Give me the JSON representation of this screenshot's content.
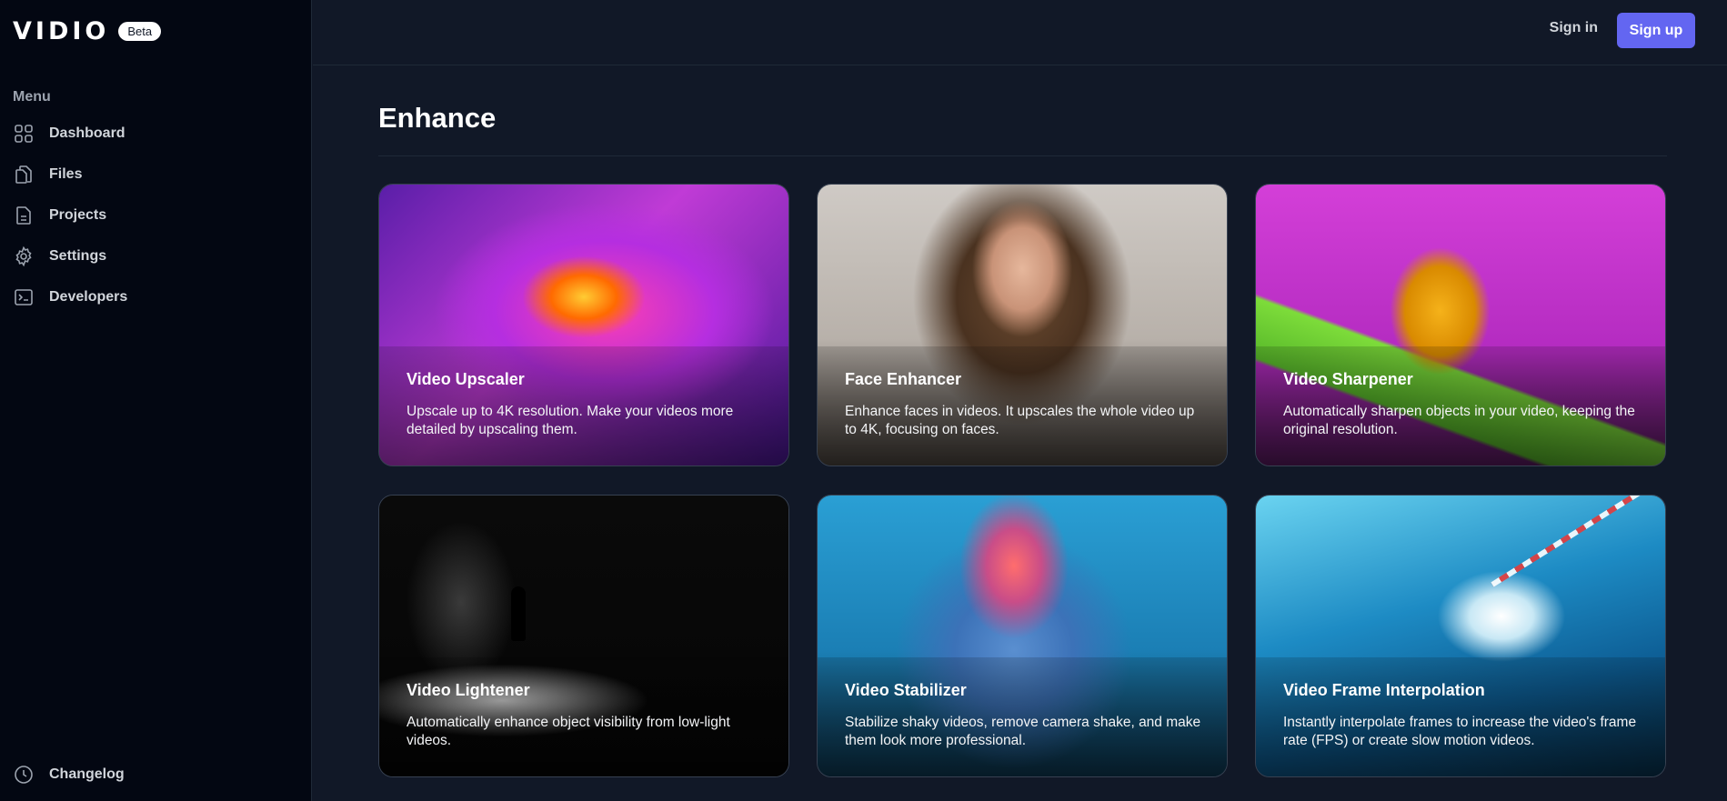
{
  "brand": {
    "logo": "VIDIO",
    "badge": "Beta"
  },
  "sidebar": {
    "menu_heading": "Menu",
    "items": [
      {
        "label": "Dashboard",
        "icon": "grid-icon"
      },
      {
        "label": "Files",
        "icon": "files-icon"
      },
      {
        "label": "Projects",
        "icon": "document-icon"
      },
      {
        "label": "Settings",
        "icon": "gear-icon"
      },
      {
        "label": "Developers",
        "icon": "terminal-icon"
      }
    ],
    "changelog": {
      "label": "Changelog",
      "icon": "clock-icon"
    }
  },
  "header": {
    "sign_in": "Sign in",
    "sign_up": "Sign up"
  },
  "main": {
    "title": "Enhance",
    "cards": [
      {
        "title": "Video Upscaler",
        "desc": "Upscale up to 4K resolution. Make your videos more detailed by upscaling them."
      },
      {
        "title": "Face Enhancer",
        "desc": "Enhance faces in videos. It upscales the whole video up to 4K, focusing on faces."
      },
      {
        "title": "Video Sharpener",
        "desc": "Automatically sharpen objects in your video, keeping the original resolution."
      },
      {
        "title": "Video Lightener",
        "desc": "Automatically enhance object visibility from low-light videos."
      },
      {
        "title": "Video Stabilizer",
        "desc": "Stabilize shaky videos, remove camera shake, and make them look more professional."
      },
      {
        "title": "Video Frame Interpolation",
        "desc": "Instantly interpolate frames to increase the video's frame rate (FPS) or create slow motion videos."
      }
    ]
  },
  "colors": {
    "accent": "#6366f1",
    "sidebar_bg": "#030712",
    "page_bg": "#111827"
  }
}
